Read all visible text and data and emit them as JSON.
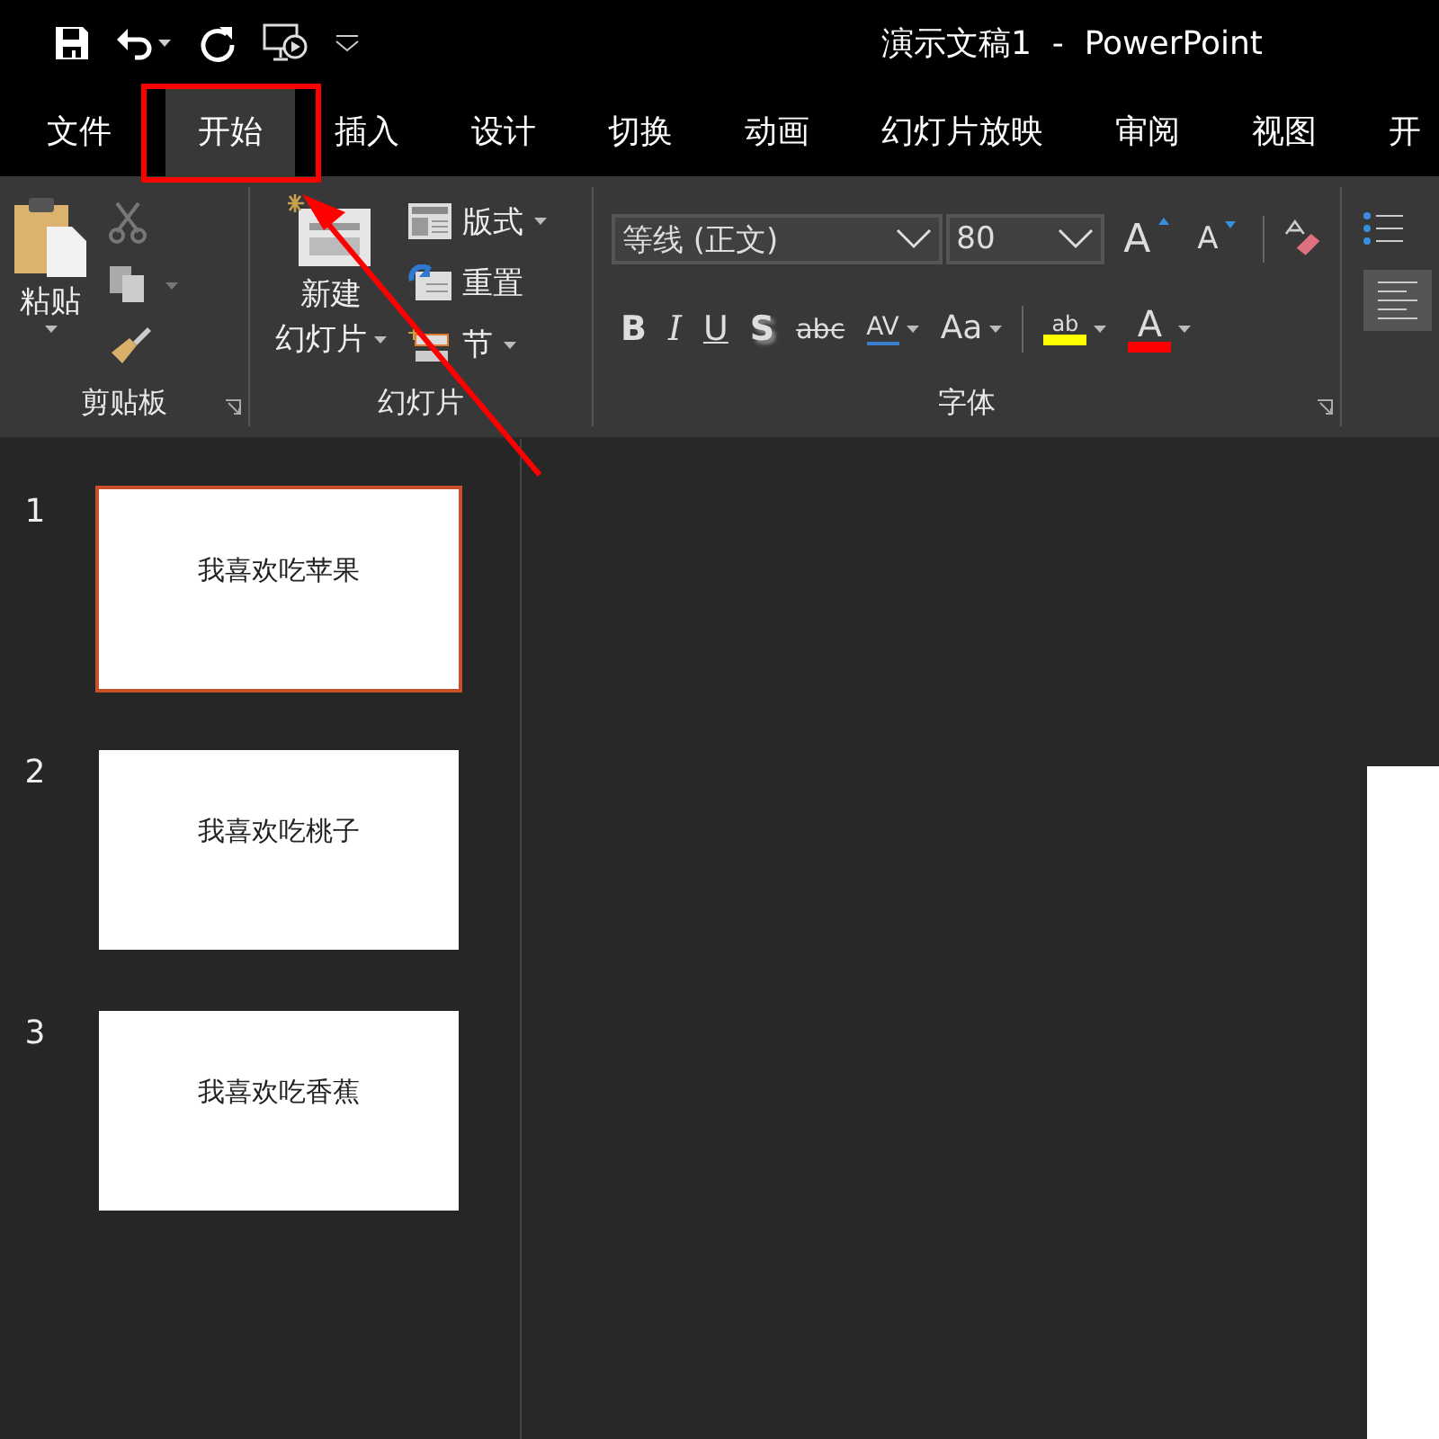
{
  "window": {
    "title": "演示文稿1  -  PowerPoint"
  },
  "tabs": [
    {
      "label": "文件",
      "selected": false
    },
    {
      "label": "开始",
      "selected": true
    },
    {
      "label": "插入",
      "selected": false
    },
    {
      "label": "设计",
      "selected": false
    },
    {
      "label": "切换",
      "selected": false
    },
    {
      "label": "动画",
      "selected": false
    },
    {
      "label": "幻灯片放映",
      "selected": false
    },
    {
      "label": "审阅",
      "selected": false
    },
    {
      "label": "视图",
      "selected": false
    },
    {
      "label": "开",
      "selected": false
    }
  ],
  "ribbon": {
    "clipboard": {
      "paste": "粘贴",
      "label": "剪贴板"
    },
    "slides": {
      "new_slide": "新建",
      "new_slide_2": "幻灯片",
      "layout": "版式",
      "reset": "重置",
      "section": "节",
      "label": "幻灯片"
    },
    "font": {
      "font_name": "等线 (正文)",
      "font_size": "80",
      "grow": "A",
      "shrink": "A",
      "label": "字体",
      "format_buttons": [
        {
          "label": "B",
          "kind": "bold"
        },
        {
          "label": "I",
          "kind": "italic"
        },
        {
          "label": "U",
          "kind": "underline"
        },
        {
          "label": "S",
          "kind": "shadow"
        },
        {
          "label": "abc",
          "kind": "strike"
        },
        {
          "label": "AV",
          "kind": "spacing"
        },
        {
          "label": "Aa",
          "kind": "case"
        }
      ],
      "highlight": "ab",
      "font_color": "A"
    }
  },
  "slides": [
    {
      "number": "1",
      "text": "我喜欢吃苹果",
      "selected": true
    },
    {
      "number": "2",
      "text": "我喜欢吃桃子",
      "selected": false
    },
    {
      "number": "3",
      "text": "我喜欢吃香蕉",
      "selected": false
    }
  ]
}
